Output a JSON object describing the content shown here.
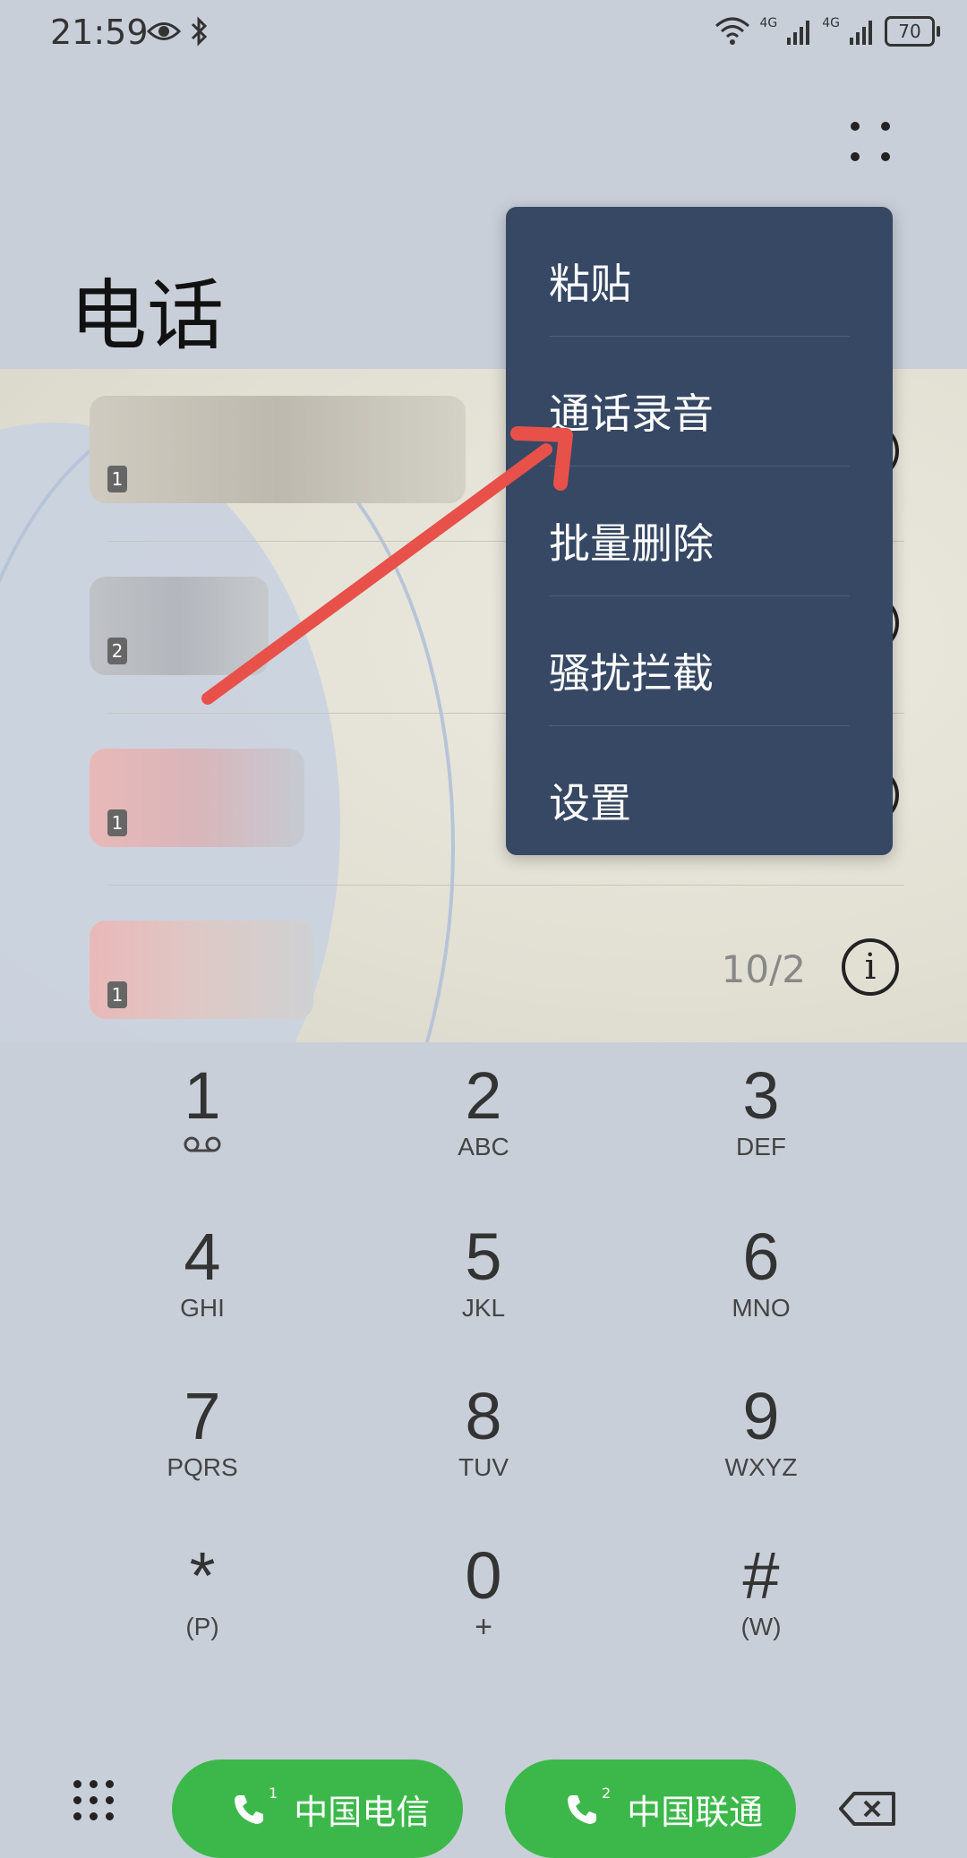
{
  "status_bar": {
    "time": "21:59",
    "network_1": "4G",
    "network_2": "4G",
    "battery": "70"
  },
  "header": {
    "title": "电话"
  },
  "menu": {
    "items": [
      {
        "label": "粘贴"
      },
      {
        "label": "通话录音"
      },
      {
        "label": "批量删除"
      },
      {
        "label": "骚扰拦截"
      },
      {
        "label": "设置"
      }
    ]
  },
  "call_log": {
    "rows": [
      {
        "sim": "1",
        "date": ""
      },
      {
        "sim": "2",
        "date": ""
      },
      {
        "sim": "1",
        "date": ""
      },
      {
        "sim": "1",
        "date": "10/2"
      }
    ]
  },
  "dialpad": {
    "keys": [
      {
        "digit": "1",
        "letters": ""
      },
      {
        "digit": "2",
        "letters": "ABC"
      },
      {
        "digit": "3",
        "letters": "DEF"
      },
      {
        "digit": "4",
        "letters": "GHI"
      },
      {
        "digit": "5",
        "letters": "JKL"
      },
      {
        "digit": "6",
        "letters": "MNO"
      },
      {
        "digit": "7",
        "letters": "PQRS"
      },
      {
        "digit": "8",
        "letters": "TUV"
      },
      {
        "digit": "9",
        "letters": "WXYZ"
      },
      {
        "digit": "*",
        "letters": "(P)"
      },
      {
        "digit": "0",
        "letters": "+"
      },
      {
        "digit": "#",
        "letters": "(W)"
      }
    ]
  },
  "bottom_bar": {
    "call_sim1_label": "中国电信",
    "call_sim2_label": "中国联通",
    "sim1_badge": "1",
    "sim2_badge": "2"
  },
  "colors": {
    "background": "#c9cfd9",
    "menu_background": "#364863",
    "call_button": "#3cb84a",
    "missed_call": "#e03a3a",
    "arrow": "#e8504a"
  }
}
